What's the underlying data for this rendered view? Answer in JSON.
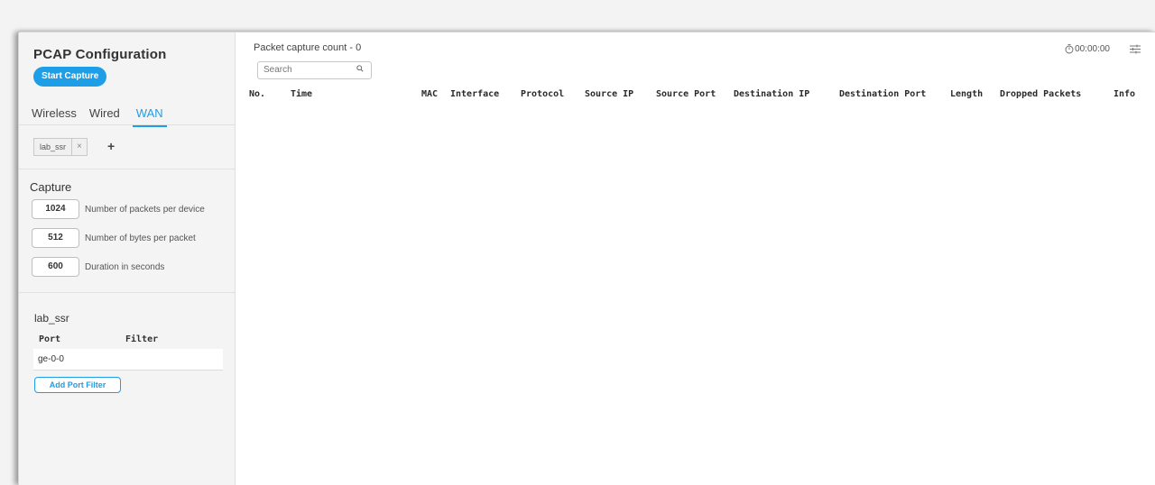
{
  "sidebar": {
    "title": "PCAP Configuration",
    "start_button": "Start Capture",
    "tabs": [
      {
        "label": "Wireless",
        "active": false
      },
      {
        "label": "Wired",
        "active": false
      },
      {
        "label": "WAN",
        "active": true
      }
    ],
    "chip": {
      "label": "lab_ssr",
      "remove": "×"
    },
    "add_symbol": "+",
    "capture": {
      "title": "Capture",
      "rows": [
        {
          "value": "1024",
          "label": "Number of packets per device"
        },
        {
          "value": "512",
          "label": "Number of bytes per packet"
        },
        {
          "value": "600",
          "label": "Duration in seconds"
        }
      ]
    },
    "device": {
      "name": "lab_ssr",
      "port_header": "Port",
      "filter_header": "Filter",
      "ports": [
        {
          "port": "ge-0-0",
          "filter": ""
        }
      ],
      "add_filter_button": "Add Port Filter"
    }
  },
  "main": {
    "count_title": "Packet capture count - 0",
    "search_placeholder": "Search",
    "timer": "00:00:00",
    "columns": [
      "No.",
      "Time",
      "MAC",
      "Interface",
      "Protocol",
      "Source IP",
      "Source Port",
      "Destination IP",
      "Destination Port",
      "Length",
      "Dropped Packets",
      "Info"
    ]
  },
  "colors": {
    "accent": "#1e9ee6",
    "sidebar_bg": "#f4f4f4"
  },
  "icons": {
    "search": "search-icon",
    "timer": "stopwatch-icon",
    "settings": "sliders-icon",
    "remove": "close-icon",
    "add": "plus-icon"
  }
}
